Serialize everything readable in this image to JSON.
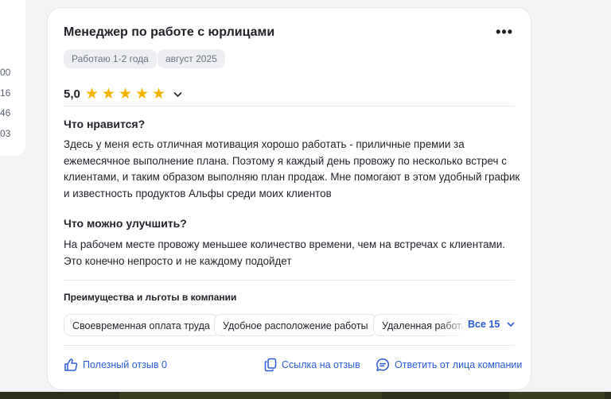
{
  "left_panel": {
    "numbers": [
      "00",
      "16",
      "46",
      "03"
    ]
  },
  "review": {
    "title": "Менеджер по работе с юрлицами",
    "more_label": "•••",
    "tags": [
      "Работаю 1-2 года",
      "август 2025"
    ],
    "rating": {
      "value_text": "5,0",
      "stars": 5,
      "max": 5
    },
    "likes_heading": "Что нравится?",
    "likes_text": "Здесь у меня есть отличная мотивация хорошо работать - приличные премии за ежемесячное выполнение плана. Поэтому я каждый день провожу по несколько встреч с клиентами, и таким образом выполняю план продаж. Мне помогают в этом удобный график и известность продуктов Альфы среди моих клиентов",
    "improve_heading": "Что можно улучшить?",
    "improve_text": "На рабочем месте провожу меньшее количество времени, чем на встречах с клиентами. Это конечно непросто и не каждому подойдет",
    "benefits_heading": "Преимущества и льготы в компании",
    "benefits": [
      "Своевременная оплата труда",
      "Удобное расположение работы",
      "Удаленная работа"
    ],
    "benefits_show_all": "Все 15",
    "actions": {
      "helpful": "Полезный отзыв 0",
      "link": "Ссылка на отзыв",
      "reply": "Ответить от лица компании"
    }
  },
  "colors": {
    "accent": "#2a5bd7",
    "star": "#f5b301",
    "tag_bg": "#eceef2"
  }
}
